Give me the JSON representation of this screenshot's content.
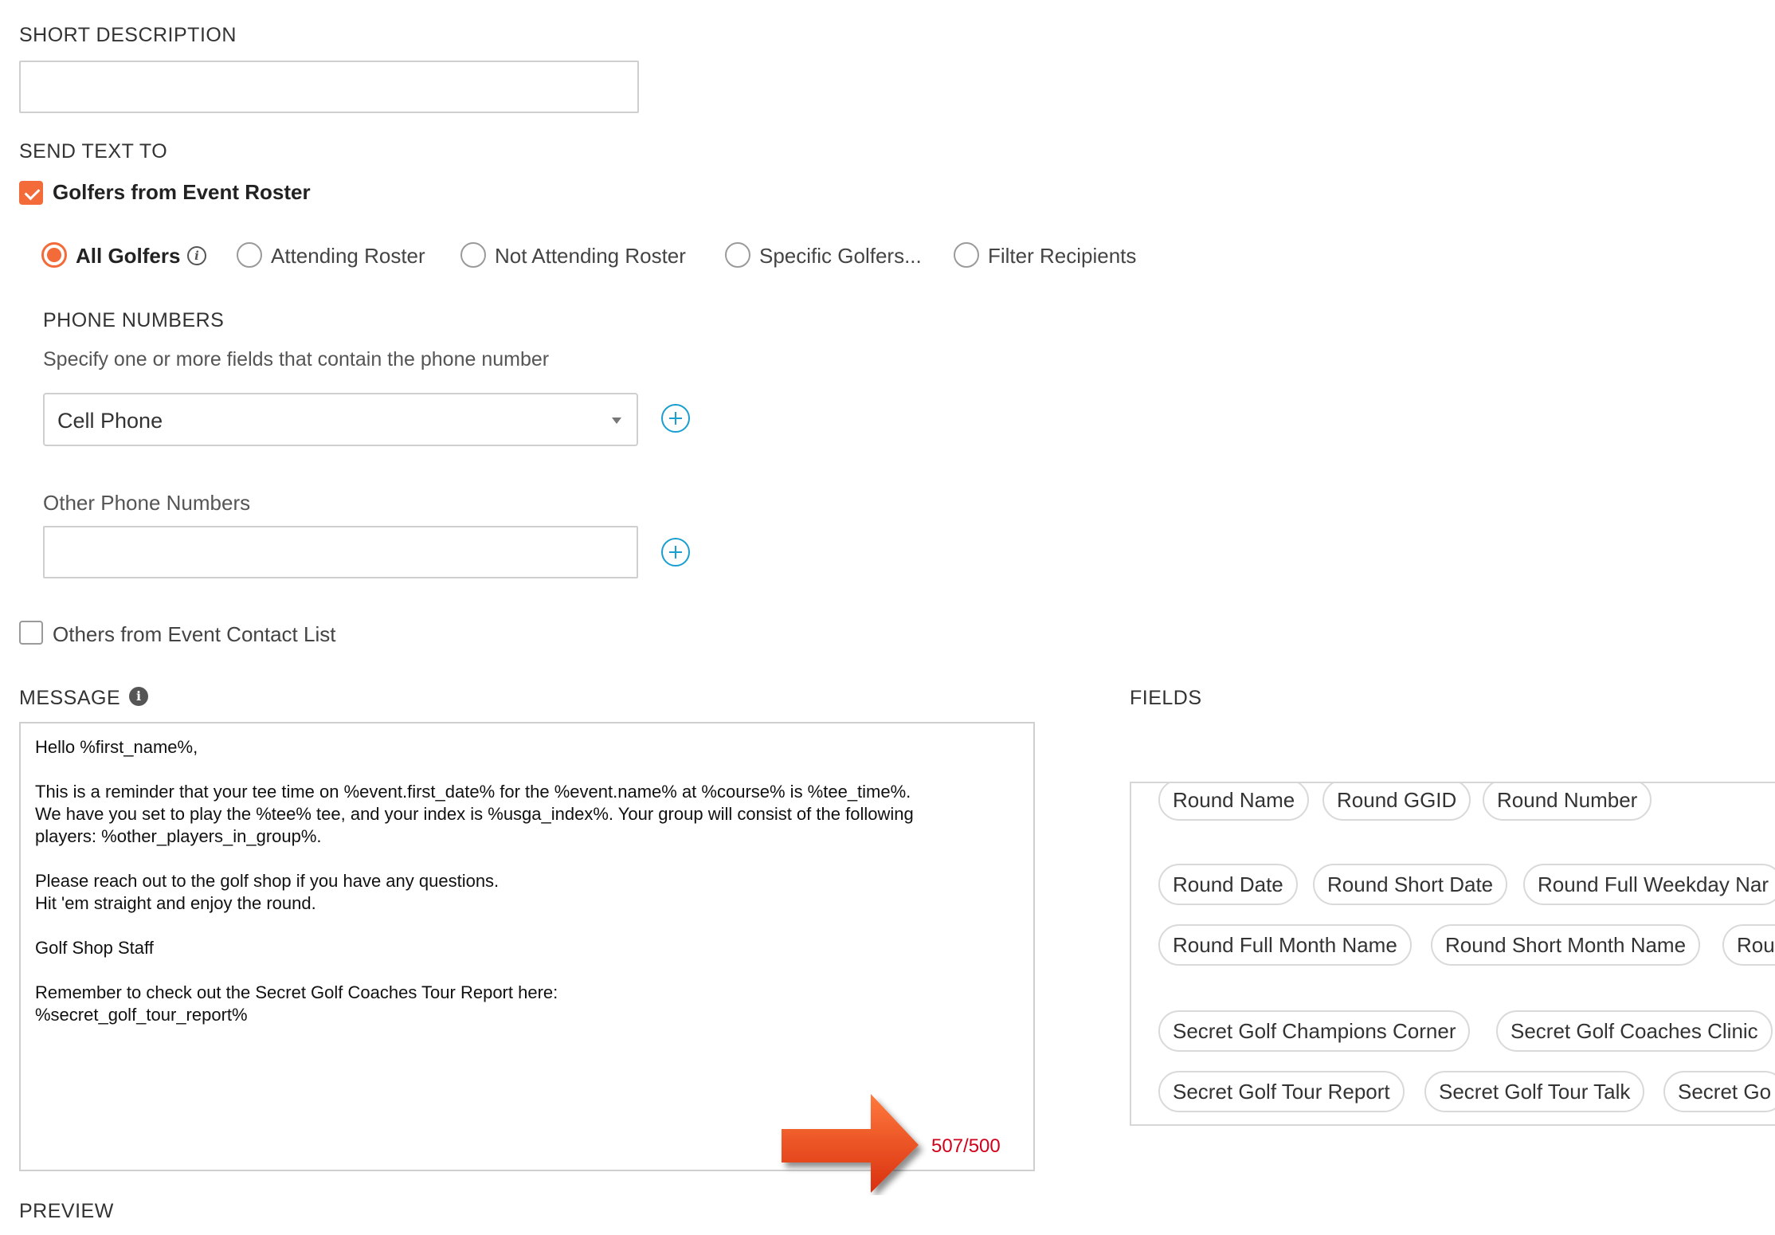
{
  "short_description": {
    "label": "SHORT DESCRIPTION",
    "value": ""
  },
  "send_text_to": {
    "label": "SEND TEXT TO",
    "golfers_checkbox": {
      "label": "Golfers from Event Roster",
      "checked": true
    },
    "radio_options": [
      {
        "label": "All Golfers",
        "selected": true
      },
      {
        "label": "Attending Roster",
        "selected": false
      },
      {
        "label": "Not Attending Roster",
        "selected": false
      },
      {
        "label": "Specific Golfers...",
        "selected": false
      },
      {
        "label": "Filter Recipients",
        "selected": false
      }
    ],
    "others_checkbox": {
      "label": "Others from Event Contact List",
      "checked": false
    }
  },
  "phone_numbers": {
    "label": "PHONE NUMBERS",
    "hint": "Specify one or more fields that contain the phone number",
    "selected_field": "Cell Phone",
    "other_label": "Other Phone Numbers",
    "other_value": ""
  },
  "message": {
    "label": "MESSAGE",
    "lines": [
      "Hello %first_name%,",
      "",
      "This is a reminder that your tee time on %event.first_date% for the %event.name% at %course% is %tee_time%.",
      "We have you set to play the %tee% tee, and your index is %usga_index%. Your group will consist of the following",
      "players: %other_players_in_group%.",
      "",
      "Please reach out to the golf shop if you have any questions.",
      "Hit 'em straight and enjoy the round.",
      "",
      "Golf Shop Staff",
      "",
      "Remember to check out the Secret Golf Coaches Tour Report here:",
      "%secret_golf_tour_report%"
    ],
    "char_count": "507/500"
  },
  "fields": {
    "label": "FIELDS",
    "chips": [
      "Round Name",
      "Round GGID",
      "Round Number",
      "Round Date",
      "Round Short Date",
      "Round Full Weekday Nar",
      "Round Full Month Name",
      "Round Short Month Name",
      "Rour",
      "Secret Golf Champions Corner",
      "Secret Golf Coaches Clinic",
      "Secret Golf Tour Report",
      "Secret Golf Tour Talk",
      "Secret Go"
    ]
  },
  "preview": {
    "label": "PREVIEW"
  },
  "colors": {
    "accent": "#f26b39",
    "link": "#1b9ed0",
    "warning": "#d0021b",
    "arrow": "#e8401c"
  }
}
